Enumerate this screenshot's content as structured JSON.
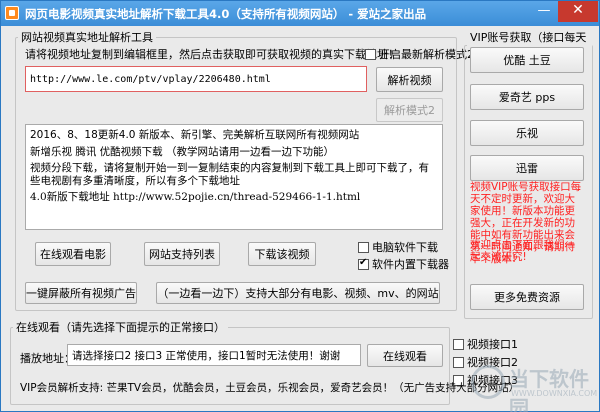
{
  "window": {
    "title": "网页电影视频真实地址解析下载工具4.0（支持所有视频网站） - 爱站之家出品",
    "min_glyph": "—",
    "close_glyph": "✕"
  },
  "left_panel": {
    "legend": "网站视频真实地址解析工具",
    "instruction": "请将视频地址复制到编辑框里，然后点击获取即可获取视频的真实下载地址！",
    "mode2_checkbox_label": "开启最新解析模式2",
    "mode2_checked": false,
    "url_value": "http://www.le.com/ptv/vplay/2206480.html",
    "parse_button": "解析视频",
    "parse_mode2_button": "解析模式2",
    "memo_lines": [
      "2016、8、18更新4.0 新版本、新引擎、完美解析互联网所有视频网站",
      "新增乐视 腾讯 优酷视频下载 （教学网站请用一边看一边下功能）",
      "视频分段下载，请将复制开始一到一复制结束的内容复制到下载工具上即可下载了，有些电视剧有多重清晰度，所以有多个下载地址",
      "4.0新版下载地址 http://www.52pojie.cn/thread-529466-1-1.html"
    ],
    "watch_online_button": "在线观看电影",
    "supported_sites_button": "网站支持列表",
    "download_video_button": "下载该视频",
    "pc_software_download_label": "电脑软件下载",
    "pc_software_download_checked": false,
    "builtin_downloader_label": "软件内置下载器",
    "builtin_downloader_checked": true,
    "block_ads_button": "一键屏蔽所有视频广告",
    "watch_and_download_button": "（一边看一边下）支持大部分有电影、视频、mv、的网站"
  },
  "right_panel": {
    "legend": "VIP账号获取（接口每天更新）",
    "buttons": [
      "优酷 土豆",
      "爱奇艺 pps",
      "乐视",
      "迅雷"
    ],
    "red_note": "视频VIP账号获取接口每天不定时更新，欢迎大家使用！新版本功能更强大，正在开发新的功能中如有新功能出来会第一时间通知，请期待下个版本!",
    "red_note2": "欢迎点击下面跟我们一起交流研究!",
    "more_resources_button": "更多免费资源"
  },
  "bottom_panel": {
    "legend": "在线观看（请先选择下面提示的正常接口）",
    "play_address_label": "播放地址：",
    "play_address_value": "请选择接口2 接口3 正常使用，接口1暂时无法使用！谢谢",
    "watch_button": "在线观看",
    "interfaces": [
      {
        "label": "视频接口1",
        "checked": false
      },
      {
        "label": "视频接口2",
        "checked": false
      },
      {
        "label": "视频接口3",
        "checked": false
      }
    ],
    "vip_support_text": "VIP会员解析支持: 芒果TV会员，优酷会员，土豆会员，乐视会员，爱奇艺会员！（无广告支持大部分网站）"
  },
  "watermark": {
    "brand": "当下软件园",
    "url": "WWW.DOWNXIA.COM"
  }
}
